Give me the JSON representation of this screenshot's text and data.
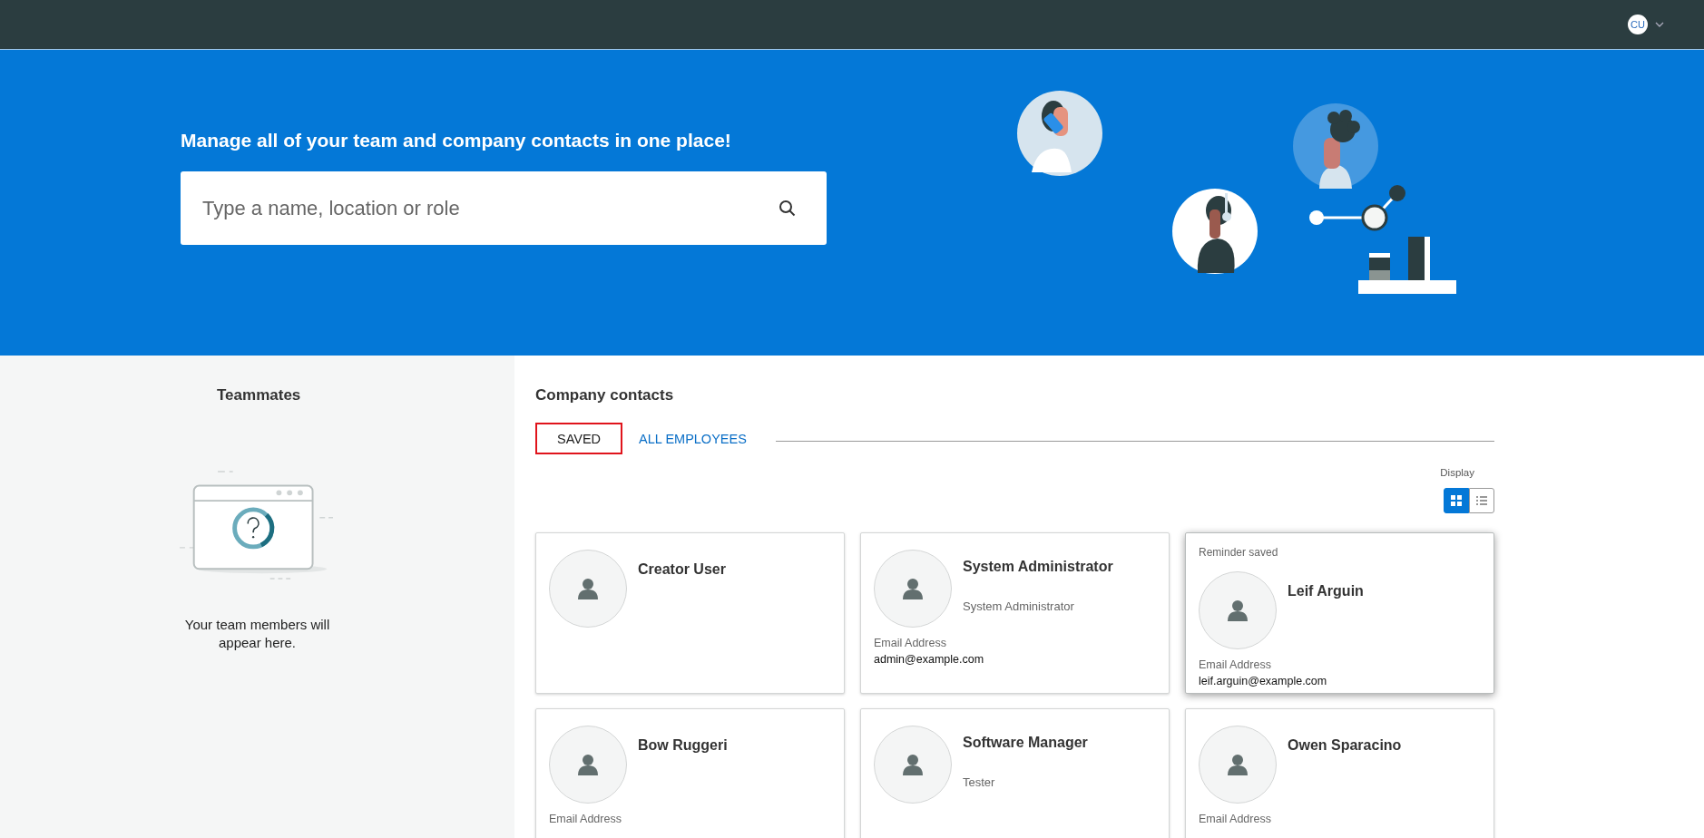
{
  "top_bar": {
    "user_initials": "CU"
  },
  "hero": {
    "headline": "Manage all of your team and company contacts in one place!",
    "search": {
      "placeholder": "Type a name, location or role"
    }
  },
  "teammates": {
    "title": "Teammates",
    "empty_message": "Your team members will appear here."
  },
  "company_contacts": {
    "title": "Company contacts",
    "tabs": [
      {
        "label": "SAVED",
        "selected": true
      },
      {
        "label": "ALL EMPLOYEES",
        "selected": false
      }
    ],
    "display": {
      "label": "Display",
      "options": [
        {
          "kind": "grid",
          "selected": true
        },
        {
          "kind": "list",
          "selected": false
        }
      ]
    },
    "contacts": [
      {
        "name": "Creator User",
        "highlighted": false
      },
      {
        "name": "System Administrator",
        "title": "System Administrator",
        "email_label": "Email Address",
        "email": "admin@example.com",
        "highlighted": false
      },
      {
        "notice": "Reminder saved",
        "name": "Leif Arguin",
        "email_label": "Email Address",
        "email": "leif.arguin@example.com",
        "highlighted": true
      },
      {
        "name": "Bow Ruggeri",
        "email_label": "Email Address",
        "highlighted": false
      },
      {
        "name": "Software Manager",
        "title": "Tester",
        "highlighted": false
      },
      {
        "name": "Owen Sparacino",
        "email_label": "Email Address",
        "highlighted": false
      }
    ]
  }
}
